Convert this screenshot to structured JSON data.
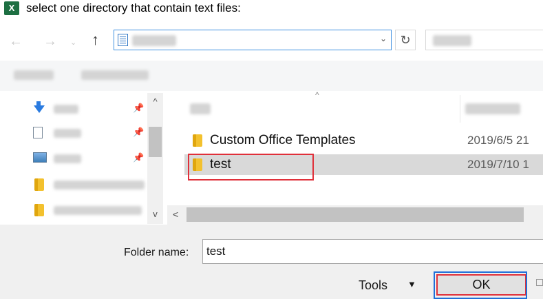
{
  "window": {
    "title": "select one directory that contain text files:",
    "app_icon_label": "X",
    "app_icon_color": "#1d6f42"
  },
  "navigation": {
    "back_icon": "←",
    "forward_icon": "→",
    "recent_icon": "⌄",
    "up_icon": "↑",
    "refresh_icon": "↻",
    "address_dropdown_icon": "⌄"
  },
  "nav_pane": {
    "pin_icon": "📌",
    "scroll_up_icon": "^",
    "scroll_down_icon": "v"
  },
  "content": {
    "sort_caret": "^",
    "hscroll_left_icon": "<",
    "rows": [
      {
        "name": "Custom Office Templates",
        "date": "2019/6/5 21"
      },
      {
        "name": "test",
        "date": "2019/7/10 1"
      }
    ]
  },
  "footer": {
    "folder_name_label": "Folder name:",
    "folder_name_value": "test",
    "tools_label": "Tools",
    "tools_caret": "▼",
    "ok_label": "OK"
  },
  "colors": {
    "accent_border": "#3c8ee0",
    "annotation_red": "#e0303a",
    "annotation_blue": "#1f6fd8"
  }
}
